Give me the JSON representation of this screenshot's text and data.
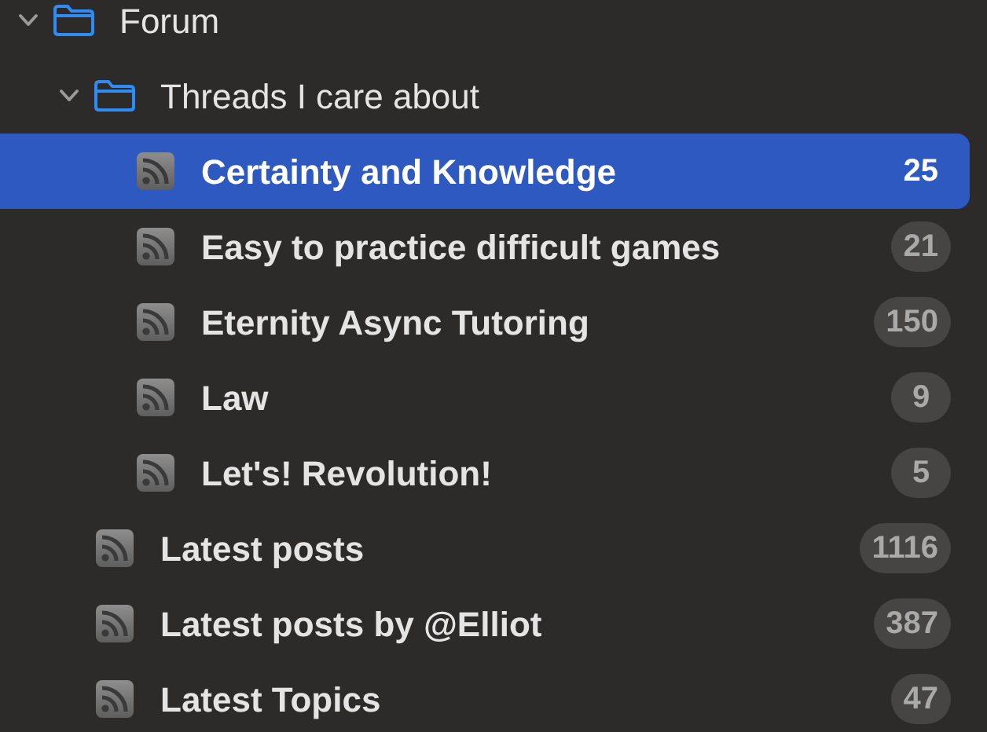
{
  "sidebar": {
    "items": [
      {
        "kind": "folder",
        "label": "Forum",
        "expanded": true,
        "selected": false,
        "children": [
          {
            "kind": "folder",
            "label": "Threads I care about",
            "expanded": true,
            "selected": false,
            "children": [
              {
                "kind": "feed",
                "label": "Certainty and Knowledge",
                "unread": "25",
                "selected": true
              },
              {
                "kind": "feed",
                "label": "Easy to practice difficult games",
                "unread": "21",
                "selected": false
              },
              {
                "kind": "feed",
                "label": "Eternity Async Tutoring",
                "unread": "150",
                "selected": false
              },
              {
                "kind": "feed",
                "label": "Law",
                "unread": "9",
                "selected": false
              },
              {
                "kind": "feed",
                "label": "Let's! Revolution!",
                "unread": "5",
                "selected": false
              }
            ]
          },
          {
            "kind": "feed",
            "label": "Latest posts",
            "unread": "1116",
            "selected": false
          },
          {
            "kind": "feed",
            "label": "Latest posts by @Elliot",
            "unread": "387",
            "selected": false
          },
          {
            "kind": "feed",
            "label": "Latest Topics",
            "unread": "47",
            "selected": false
          }
        ]
      }
    ]
  }
}
